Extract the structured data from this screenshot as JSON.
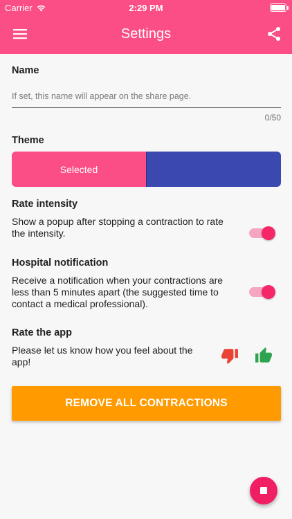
{
  "status_bar": {
    "carrier": "Carrier",
    "time": "2:29 PM"
  },
  "app_bar": {
    "title": "Settings",
    "menu_icon": "menu-icon",
    "share_icon": "share-icon"
  },
  "name": {
    "title": "Name",
    "placeholder": "If set, this name will appear on the share page.",
    "value": "",
    "counter": "0/50"
  },
  "theme": {
    "title": "Theme",
    "selected_label": "Selected",
    "options": [
      {
        "color": "#fb4d86",
        "selected": true
      },
      {
        "color": "#3a48b0",
        "selected": false
      }
    ]
  },
  "rate_intensity": {
    "title": "Rate intensity",
    "description": "Show a popup after stopping a contraction to rate the intensity.",
    "enabled": true
  },
  "hospital_notification": {
    "title": "Hospital notification",
    "description": "Receive a notification when your contractions are less than 5 minutes apart (the suggested time to contact a medical professional).",
    "enabled": true
  },
  "rate_app": {
    "title": "Rate the app",
    "description": "Please let us know how you feel about the app!",
    "thumbs_down_icon": "thumbs-down-icon",
    "thumbs_up_icon": "thumbs-up-icon",
    "thumbs_down_color": "#ea4335",
    "thumbs_up_color": "#2ea44f"
  },
  "remove_button": {
    "label": "REMOVE ALL CONTRACTIONS",
    "color": "#ff9b00"
  },
  "fab": {
    "icon": "stop-icon",
    "color": "#f01f63"
  },
  "colors": {
    "primary": "#fb4d86",
    "accent": "#f52768",
    "background": "#f7f7f7"
  }
}
